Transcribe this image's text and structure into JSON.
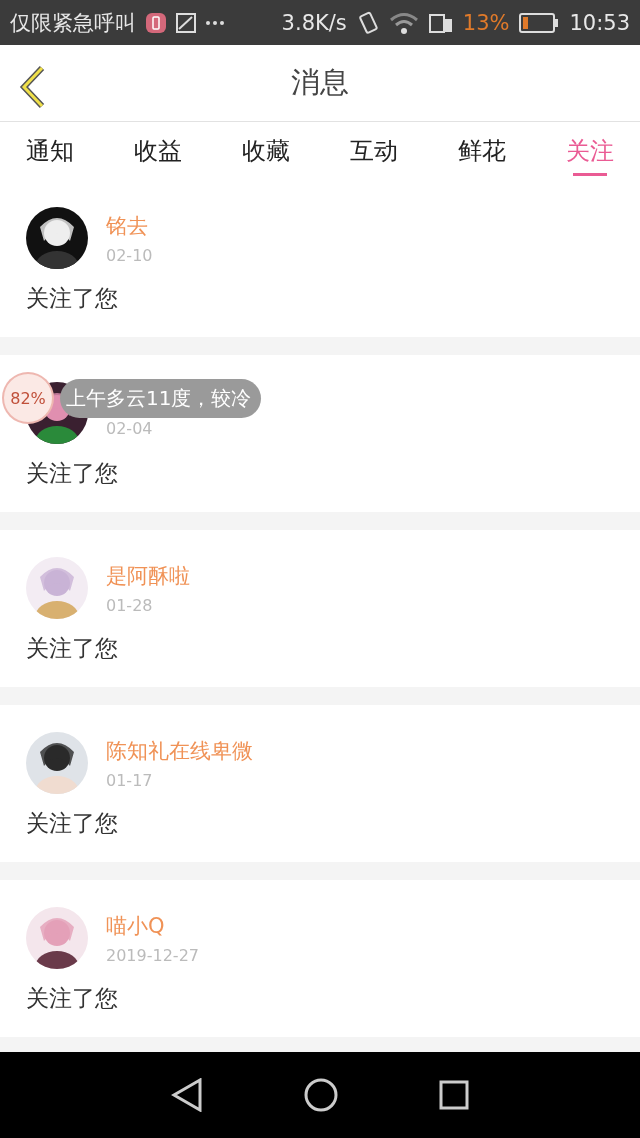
{
  "status_bar": {
    "carrier": "仅限紧急呼叫",
    "speed": "3.8K/s",
    "battery": "13%",
    "time": "10:53"
  },
  "header": {
    "title": "消息"
  },
  "tabs": [
    {
      "label": "通知",
      "selected": false
    },
    {
      "label": "收益",
      "selected": false
    },
    {
      "label": "收藏",
      "selected": false
    },
    {
      "label": "互动",
      "selected": false
    },
    {
      "label": "鲜花",
      "selected": false
    },
    {
      "label": "关注",
      "selected": true
    }
  ],
  "messages": [
    {
      "name": "铭去",
      "date": "02-10",
      "text": "关注了您"
    },
    {
      "date": "02-04",
      "text": "关注了您"
    },
    {
      "name": "是阿酥啦",
      "date": "01-28",
      "text": "关注了您"
    },
    {
      "name": "陈知礼在线卑微",
      "date": "01-17",
      "text": "关注了您"
    },
    {
      "name": "喵小Q",
      "date": "2019-12-27",
      "text": "关注了您"
    }
  ],
  "floating_widget": {
    "percent": "82%",
    "weather": "上午多云11度，较冷"
  }
}
